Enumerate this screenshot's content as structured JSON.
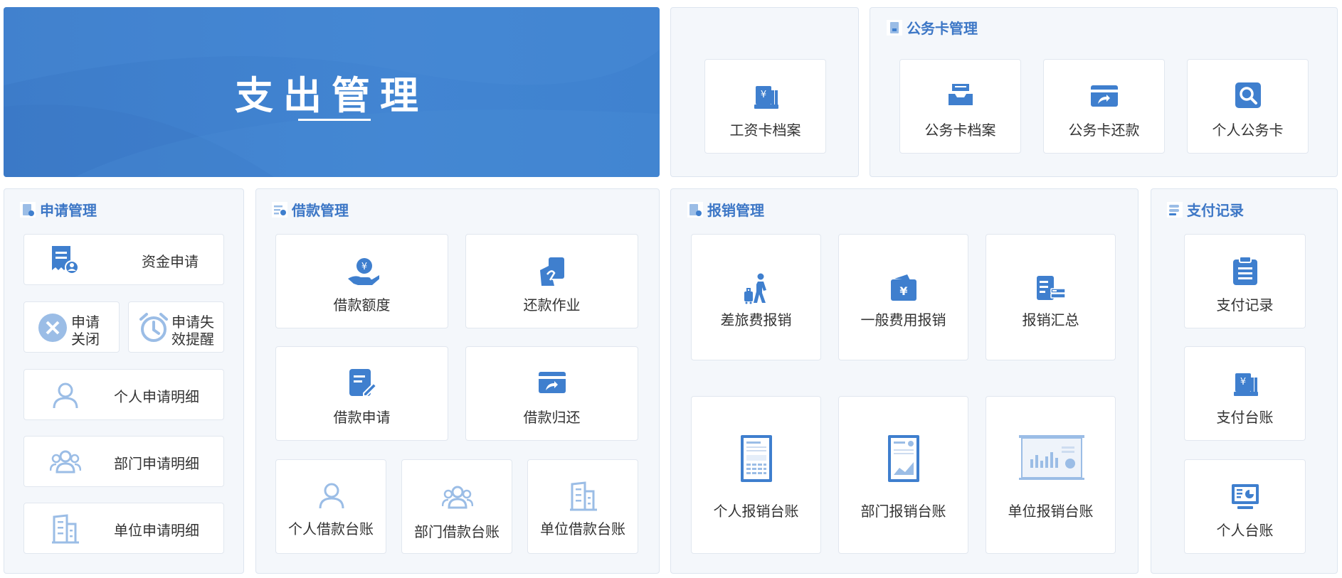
{
  "banner": {
    "title": "支出管理"
  },
  "wage": {
    "label": "工资卡档案"
  },
  "official_card": {
    "title": "公务卡管理",
    "items": [
      "公务卡档案",
      "公务卡还款",
      "个人公务卡"
    ]
  },
  "apply": {
    "title": "申请管理",
    "fund_apply": "资金申请",
    "close": {
      "line1": "申请",
      "line2": "关闭"
    },
    "expire": {
      "line1": "申请失",
      "line2": "效提醒"
    },
    "rows": [
      "个人申请明细",
      "部门申请明细",
      "单位申请明细"
    ]
  },
  "loan": {
    "title": "借款管理",
    "items": [
      "借款额度",
      "还款作业",
      "借款申请",
      "借款归还"
    ],
    "ledgers": [
      "个人借款台账",
      "部门借款台账",
      "单位借款台账"
    ]
  },
  "reimburse": {
    "title": "报销管理",
    "items": [
      "差旅费报销",
      "一般费用报销",
      "报销汇总"
    ],
    "ledgers": [
      "个人报销台账",
      "部门报销台账",
      "单位报销台账"
    ]
  },
  "payment": {
    "title": "支付记录",
    "items": [
      "支付记录",
      "支付台账",
      "个人台账"
    ]
  },
  "colors": {
    "primary": "#3d7cc9",
    "icon": "#3f7fce",
    "light_icon": "#9bbde6",
    "panel": "#f4f7fb"
  }
}
